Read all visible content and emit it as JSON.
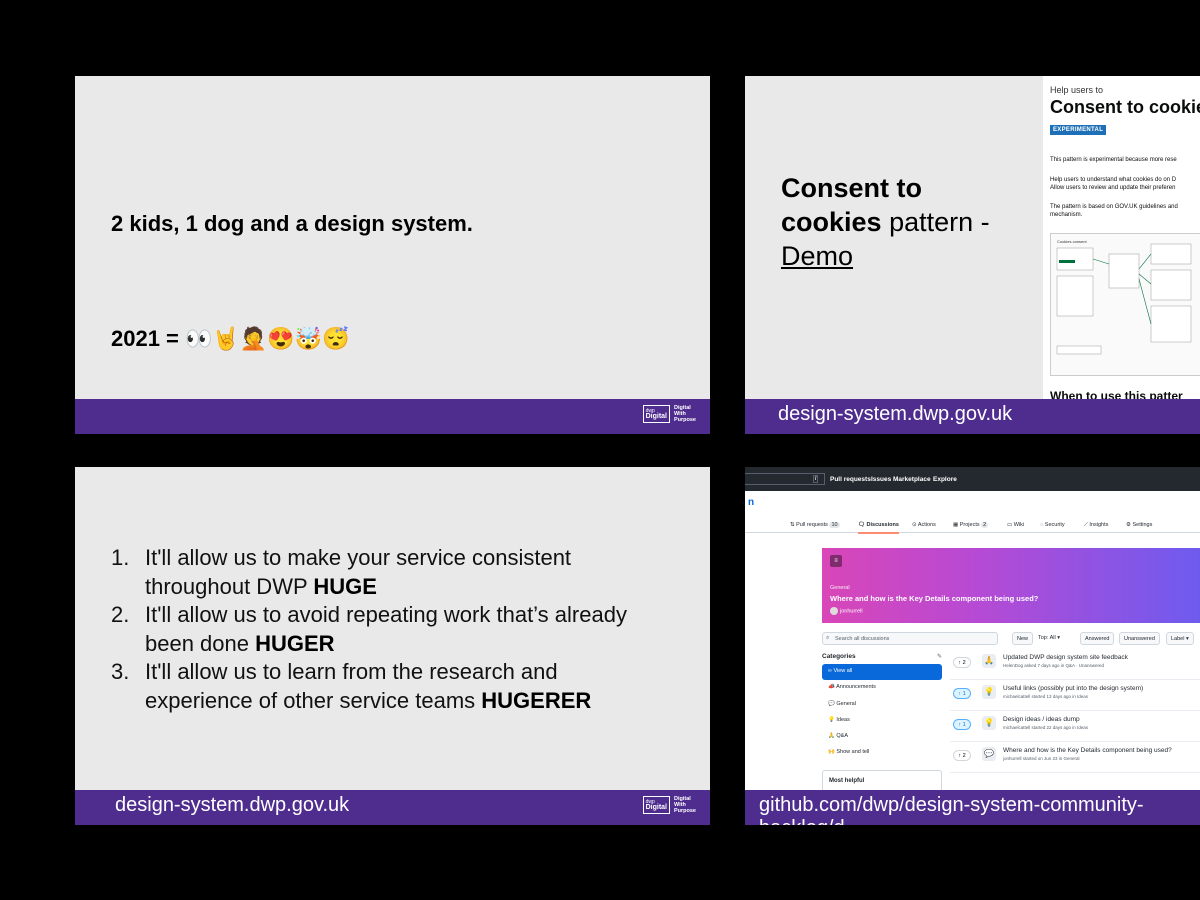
{
  "slide1": {
    "line1": "2 kids, 1 dog and a design system.",
    "line2": "2021 = 👀🤘🤦😍🤯😴",
    "logo": {
      "box_small": "dwp",
      "box_big": "Digital",
      "text": [
        "Digital",
        "With",
        "Purpose"
      ]
    }
  },
  "slide2": {
    "heading_bold1": "Consent to",
    "heading_bold2": "cookies",
    "heading_rest": " pattern -",
    "heading_link": "Demo",
    "doc": {
      "caption": "Help users to",
      "title": "Consent to cookie",
      "tag": "EXPERIMENTAL",
      "paragraphs": [
        "This pattern is experimental because more rese",
        "Help users to understand what cookies do on D",
        "Allow users to review and update their preferen",
        "The pattern is based on GOV.UK guidelines and",
        "mechanism."
      ],
      "diagram_label": "Cookies consent",
      "subheading": "When to use this patter"
    },
    "url": "design-system.dwp.gov.uk"
  },
  "slide3": {
    "items": [
      {
        "num": "1.",
        "text1": "It'll allow us to make your service consistent",
        "text2": "throughout DWP ",
        "bold": "HUGE"
      },
      {
        "num": "2.",
        "text1": "It'll allow us to avoid repeating work that’s already",
        "text2": "been done ",
        "bold": "HUGER"
      },
      {
        "num": "3.",
        "text1": "It'll allow us to learn from the research and",
        "text2": "experience of other service teams ",
        "bold": "HUGERER"
      }
    ],
    "url": "design-system.dwp.gov.uk",
    "logo": {
      "box_small": "dwp",
      "box_big": "Digital",
      "text": [
        "Digital",
        "With",
        "Purpose"
      ]
    }
  },
  "slide4": {
    "topnav": {
      "slash": "/",
      "items": [
        "Pull requests",
        "Issues",
        "Marketplace",
        "Explore"
      ]
    },
    "repo_letter": "n",
    "tabs": {
      "pull_requests": "Pull requests",
      "pull_requests_count": "10",
      "discussions": "Discussions",
      "actions": "Actions",
      "projects": "Projects",
      "projects_count": "2",
      "wiki": "Wiki",
      "security": "Security",
      "insights": "Insights",
      "settings": "Settings"
    },
    "banner": {
      "icon": "≡",
      "category": "General",
      "title": "Where and how is the Key Details component being used?",
      "user": "jonhurrell"
    },
    "search_placeholder": "Search all discussions",
    "filters": {
      "new": "New",
      "top": "Top: All ▾",
      "answered": "Answered",
      "unanswered": "Unanswered",
      "label": "Label ▾"
    },
    "categories": {
      "heading": "Categories",
      "items": [
        "∞ View all",
        "📣 Announcements",
        "💬 General",
        "💡 Ideas",
        "🙏 Q&A",
        "🙌 Show and tell"
      ]
    },
    "most_helpful": "Most helpful",
    "discussions": [
      {
        "votes": "↑ 2",
        "emoji": "🙏",
        "title": "Updated DWP design system site feedback",
        "meta": "HelenDog asked 7 days ago in Q&A · Unanswered"
      },
      {
        "votes": "↑ 1",
        "emoji": "💡",
        "title": "Useful links (possibly put into the design system)",
        "meta": "michaelcattell started 13 days ago in Ideas"
      },
      {
        "votes": "↑ 1",
        "emoji": "💡",
        "title": "Design ideas / ideas dump",
        "meta": "michaelcattell started 22 days ago in Ideas"
      },
      {
        "votes": "↑ 2",
        "emoji": "💬",
        "title": "Where and how is the Key Details component being used?",
        "meta": "jonhurrell started on Jun 23 in General"
      }
    ],
    "url": "github.com/dwp/design-system-community-backlog/d"
  },
  "colors": {
    "purple_bar": "#4f2d8f",
    "slide_bg": "#e9e9e9",
    "gov_blue": "#1d70b8"
  }
}
